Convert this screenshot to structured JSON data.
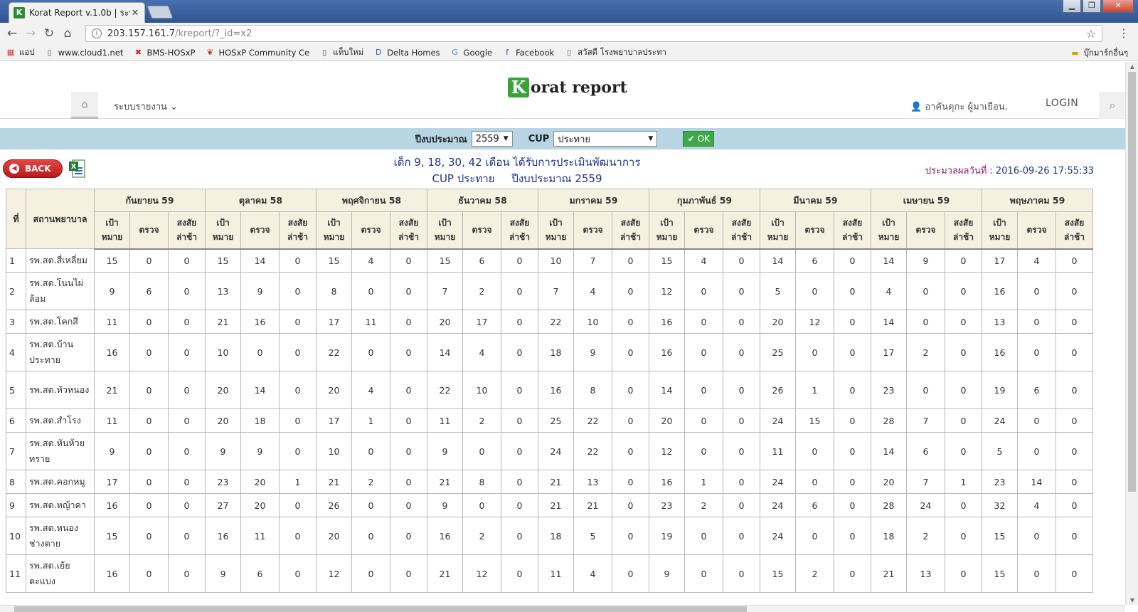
{
  "browser": {
    "tab_title": "Korat Report v.1.0b | ระบ",
    "favicon_letter": "K",
    "url_host": "203.157.161.7",
    "url_path": "/kreport/?_id=x2",
    "bookmarks": [
      {
        "icon": "apps-icon",
        "label": "แอป"
      },
      {
        "icon": "page-icon",
        "label": "www.cloud1.net"
      },
      {
        "icon": "bms-icon",
        "label": "BMS-HOSxP"
      },
      {
        "icon": "hosxp-icon",
        "label": "HOSxP Community Ce"
      },
      {
        "icon": "page-icon",
        "label": "แท็บใหม่"
      },
      {
        "icon": "delta-icon",
        "label": "Delta Homes"
      },
      {
        "icon": "google-icon",
        "label": "Google"
      },
      {
        "icon": "facebook-icon",
        "label": "Facebook"
      },
      {
        "icon": "page-icon",
        "label": "สวัสดี โรงพยาบาลประทา"
      }
    ],
    "bookmark_folder": "บุ๊กมาร์กอื่นๆ"
  },
  "header": {
    "logo_rest": "orat report",
    "menu": "ระบบรายงาน",
    "user": "อาคันตุกะ ผู้มาเยือน.",
    "login": "LOGIN"
  },
  "filter": {
    "year_label": "ปีงบประมาณ",
    "year_value": "2559",
    "cup_label": "CUP",
    "cup_value": "ประทาย",
    "ok_label": "OK"
  },
  "report": {
    "back_label": "BACK",
    "title_line1": "เด็ก 9, 18, 30, 42 เดือน ได้รับการประเมินพัฒนาการ",
    "title_line2": "CUP ประทาย     ปีงบประมาณ 2559",
    "process_label": "ประมวลผลวันที่ :",
    "process_time": "2016-09-26 17:55:33"
  },
  "table": {
    "col_no": "ที่",
    "col_name": "สถานพยาบาล",
    "sub_target": "เป้าหมาย",
    "sub_checked": "ตรวจ",
    "sub_suspect": "สงสัยล่าช้า",
    "months": [
      "กันยายน 59",
      "ตุลาคม 58",
      "พฤศจิกายน 58",
      "ธันวาคม 58",
      "มกราคม 59",
      "กุมภาพันธ์ 59",
      "มีนาคม 59",
      "เมษายน 59",
      "พฤษภาคม 59"
    ],
    "rows": [
      {
        "no": "1",
        "name": "รพ.สต.สี่เหลี่ยม",
        "values": [
          "15",
          "0",
          "0",
          "15",
          "14",
          "0",
          "15",
          "4",
          "0",
          "15",
          "6",
          "0",
          "10",
          "7",
          "0",
          "15",
          "4",
          "0",
          "14",
          "6",
          "0",
          "14",
          "9",
          "0",
          "17",
          "4",
          "0"
        ]
      },
      {
        "no": "2",
        "name": "รพ.สต.โนนไผ่ล้อม",
        "values": [
          "9",
          "6",
          "0",
          "13",
          "9",
          "0",
          "8",
          "0",
          "0",
          "7",
          "2",
          "0",
          "7",
          "4",
          "0",
          "12",
          "0",
          "0",
          "5",
          "0",
          "0",
          "4",
          "0",
          "0",
          "16",
          "0",
          "0"
        ]
      },
      {
        "no": "3",
        "name": "รพ.สต.โคกสี",
        "values": [
          "11",
          "0",
          "0",
          "21",
          "16",
          "0",
          "17",
          "11",
          "0",
          "20",
          "17",
          "0",
          "22",
          "10",
          "0",
          "16",
          "0",
          "0",
          "20",
          "12",
          "0",
          "14",
          "0",
          "0",
          "13",
          "0",
          "0"
        ]
      },
      {
        "no": "4",
        "name": "รพ.สต.บ้านประทาย",
        "values": [
          "16",
          "0",
          "0",
          "10",
          "0",
          "0",
          "22",
          "0",
          "0",
          "14",
          "4",
          "0",
          "18",
          "9",
          "0",
          "16",
          "0",
          "0",
          "25",
          "0",
          "0",
          "17",
          "2",
          "0",
          "16",
          "0",
          "0"
        ]
      },
      {
        "no": "5",
        "name": "รพ.สต.หัวหนอง",
        "values": [
          "21",
          "0",
          "0",
          "20",
          "14",
          "0",
          "20",
          "4",
          "0",
          "22",
          "10",
          "0",
          "16",
          "8",
          "0",
          "14",
          "0",
          "0",
          "26",
          "1",
          "0",
          "23",
          "0",
          "0",
          "19",
          "6",
          "0"
        ]
      },
      {
        "no": "6",
        "name": "รพ.สต.สำโรง",
        "values": [
          "11",
          "0",
          "0",
          "20",
          "18",
          "0",
          "17",
          "1",
          "0",
          "11",
          "2",
          "0",
          "25",
          "22",
          "0",
          "20",
          "0",
          "0",
          "24",
          "15",
          "0",
          "28",
          "7",
          "0",
          "24",
          "0",
          "0"
        ]
      },
      {
        "no": "7",
        "name": "รพ.สต.หันห้วยทราย",
        "values": [
          "9",
          "0",
          "0",
          "9",
          "9",
          "0",
          "10",
          "0",
          "0",
          "9",
          "0",
          "0",
          "24",
          "22",
          "0",
          "12",
          "0",
          "0",
          "11",
          "0",
          "0",
          "14",
          "6",
          "0",
          "5",
          "0",
          "0"
        ]
      },
      {
        "no": "8",
        "name": "รพ.สต.คอกหมู",
        "values": [
          "17",
          "0",
          "0",
          "23",
          "20",
          "1",
          "21",
          "2",
          "0",
          "21",
          "8",
          "0",
          "21",
          "13",
          "0",
          "16",
          "1",
          "0",
          "24",
          "0",
          "0",
          "20",
          "7",
          "1",
          "23",
          "14",
          "0"
        ]
      },
      {
        "no": "9",
        "name": "รพ.สต.หญ้าคา",
        "values": [
          "16",
          "0",
          "0",
          "27",
          "20",
          "0",
          "26",
          "0",
          "0",
          "9",
          "0",
          "0",
          "21",
          "21",
          "0",
          "23",
          "2",
          "0",
          "24",
          "6",
          "0",
          "28",
          "24",
          "0",
          "32",
          "4",
          "0"
        ]
      },
      {
        "no": "10",
        "name": "รพ.สต.หนองช่างตาย",
        "values": [
          "15",
          "0",
          "0",
          "16",
          "11",
          "0",
          "20",
          "0",
          "0",
          "16",
          "2",
          "0",
          "18",
          "5",
          "0",
          "19",
          "0",
          "0",
          "24",
          "0",
          "0",
          "18",
          "2",
          "0",
          "15",
          "0",
          "0"
        ]
      },
      {
        "no": "11",
        "name": "รพ.สต.เย้ยตะแบง",
        "values": [
          "16",
          "0",
          "0",
          "9",
          "6",
          "0",
          "12",
          "0",
          "0",
          "21",
          "12",
          "0",
          "11",
          "4",
          "0",
          "9",
          "0",
          "0",
          "15",
          "2",
          "0",
          "21",
          "13",
          "0",
          "15",
          "0",
          "0"
        ]
      }
    ]
  },
  "colors": {
    "filter_bar": "#b7d5e3",
    "header_bg": "#f6f0e0",
    "title_text": "#21318f",
    "ok_button": "#3ea84a",
    "back_button": "#d22a2a"
  }
}
